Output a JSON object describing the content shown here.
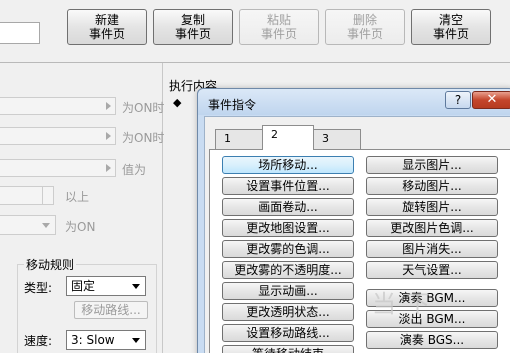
{
  "toolbar": {
    "buttons": [
      {
        "line1": "新建",
        "line2": "事件页"
      },
      {
        "line1": "复制",
        "line2": "事件页"
      },
      {
        "line1": "粘贴",
        "line2": "事件页"
      },
      {
        "line1": "删除",
        "line2": "事件页"
      },
      {
        "line1": "清空",
        "line2": "事件页"
      }
    ]
  },
  "conditions": {
    "switch1_suffix": "为ON时",
    "switch2_suffix": "为ON时",
    "variable_suffix": "值为",
    "spin_suffix": "以上",
    "self_switch_suffix": "为ON"
  },
  "move_rule": {
    "title": "移动规则",
    "type_label": "类型:",
    "type_value": "固定",
    "route_button": "移动路线...",
    "speed_label": "速度:",
    "speed_value": "3: Slow"
  },
  "exec": {
    "label": "执行内容",
    "bullet": "◆"
  },
  "dialog": {
    "title": "事件指令",
    "help": "?",
    "close": "✕",
    "tabs": [
      "1",
      "2",
      "3"
    ],
    "left_buttons": [
      "场所移动...",
      "设置事件位置...",
      "画面卷动...",
      "更改地图设置...",
      "更改雾的色调...",
      "更改雾的不透明度...",
      "显示动画...",
      "更改透明状态...",
      "设置移动路线...",
      "等待移动结束"
    ],
    "right_buttons": [
      "显示图片...",
      "移动图片...",
      "旋转图片...",
      "更改图片色调...",
      "图片消失...",
      "天气设置...",
      "演奏 BGM...",
      "淡出 BGM...",
      "演奏 BGS..."
    ]
  },
  "watermark": {
    "text": "当下"
  }
}
